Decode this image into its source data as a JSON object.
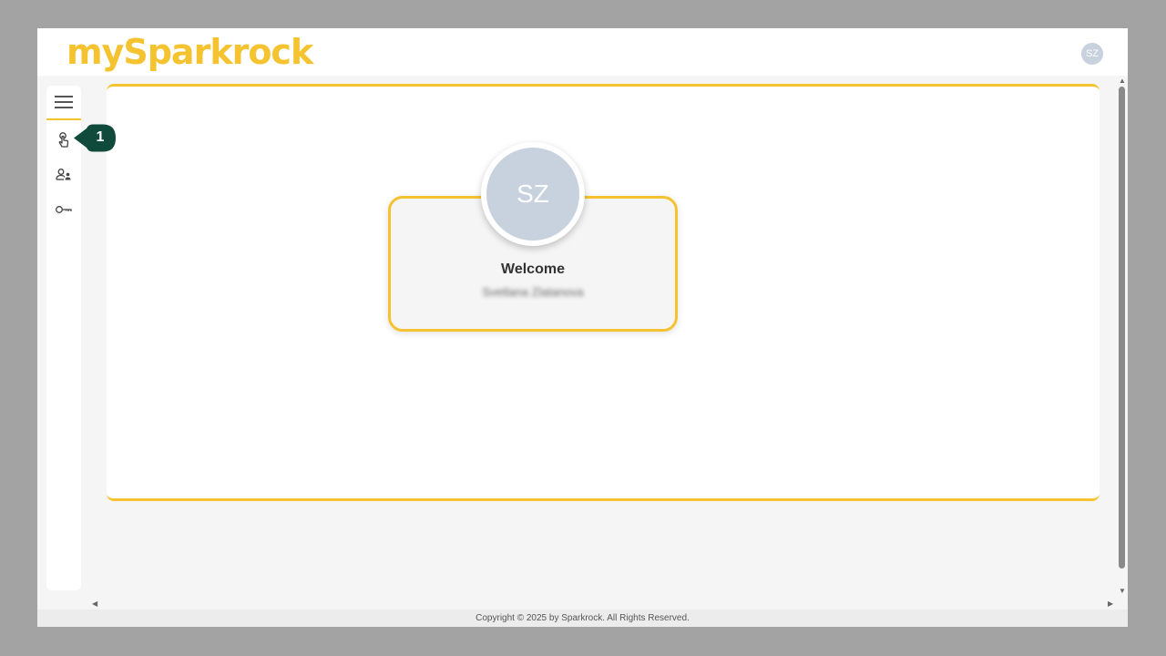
{
  "app": {
    "logo_text": "mySparkrock",
    "user_initials": "SZ"
  },
  "sidebar": {
    "menu_icon": "hamburger-icon",
    "items": [
      {
        "icon": "touch-icon"
      },
      {
        "icon": "user-manage-icon"
      },
      {
        "icon": "key-icon"
      }
    ]
  },
  "main": {
    "welcome_label": "Welcome",
    "user_name": "Svetlana Zlatanova",
    "avatar_initials": "SZ"
  },
  "footer": {
    "copyright": "Copyright © 2025 by Sparkrock. All Rights Reserved."
  },
  "callout": {
    "number": "1"
  },
  "colors": {
    "accent": "#f6c330",
    "callout": "#0f4a3a",
    "avatar": "#c8d1de"
  }
}
